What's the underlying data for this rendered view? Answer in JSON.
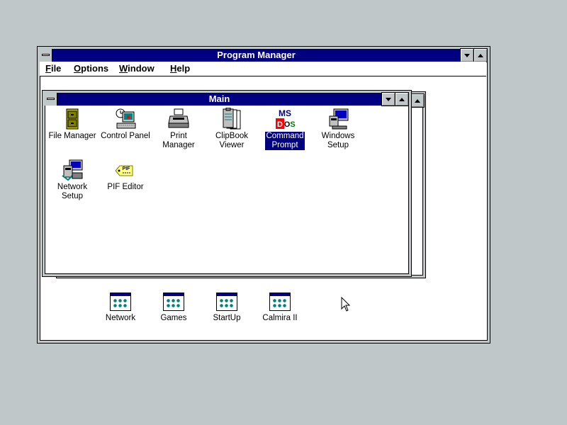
{
  "program_manager": {
    "title": "Program Manager",
    "menu": [
      "File",
      "Options",
      "Window",
      "Help"
    ]
  },
  "main_group": {
    "title": "Main",
    "icons": [
      {
        "label1": "File Manager",
        "label2": "",
        "icon": "file-cabinet-icon"
      },
      {
        "label1": "Control Panel",
        "label2": "",
        "icon": "control-panel-icon"
      },
      {
        "label1": "Print Manager",
        "label2": "",
        "icon": "printer-icon"
      },
      {
        "label1": "ClipBook",
        "label2": "Viewer",
        "icon": "clipbook-icon"
      },
      {
        "label1": "Command",
        "label2": "Prompt",
        "icon": "ms-dos-icon",
        "selected": true
      },
      {
        "label1": "Windows",
        "label2": "Setup",
        "icon": "windows-setup-icon"
      },
      {
        "label1": "Network Setup",
        "label2": "",
        "icon": "network-setup-icon"
      },
      {
        "label1": "PIF Editor",
        "label2": "",
        "icon": "pif-editor-icon"
      }
    ]
  },
  "group_icons": [
    {
      "label": "Network"
    },
    {
      "label": "Games"
    },
    {
      "label": "StartUp"
    },
    {
      "label": "Calmira II"
    }
  ],
  "colors": {
    "desktop": "#c0c7c8",
    "active_title": "#000080",
    "selection": "#000080"
  }
}
